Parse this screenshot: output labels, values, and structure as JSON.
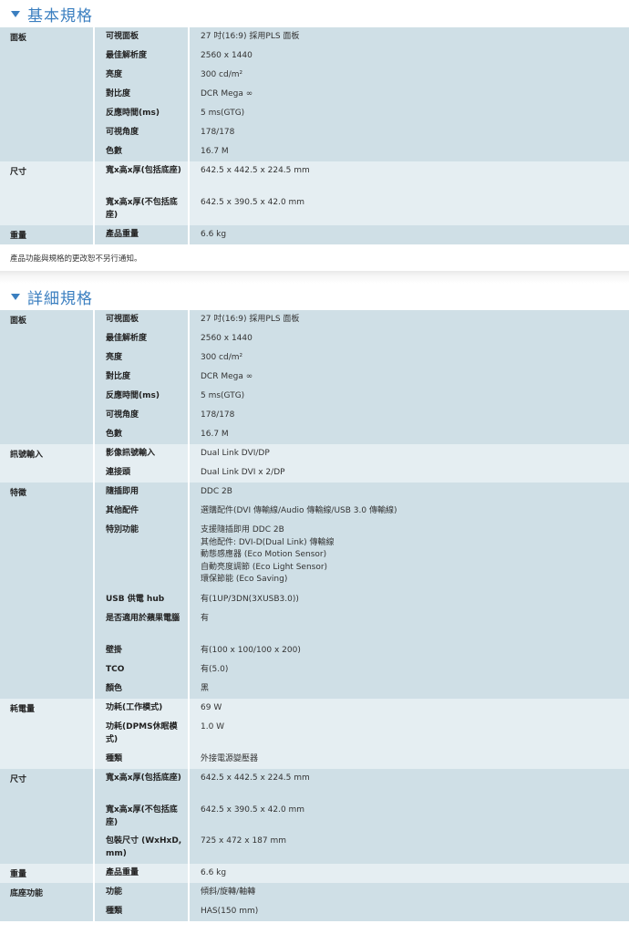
{
  "basic": {
    "title": "基本規格",
    "groups": [
      {
        "label": "面板",
        "rows": [
          {
            "name": "可視面板",
            "value": "27 吋(16:9) 採用PLS 面板"
          },
          {
            "name": "最佳解析度",
            "value": "2560 x 1440"
          },
          {
            "name": "亮度",
            "value": "300 cd/m²"
          },
          {
            "name": "對比度",
            "value": "DCR Mega ∞"
          },
          {
            "name": "反應時間(ms)",
            "value": "5 ms(GTG)"
          },
          {
            "name": "可視角度",
            "value": "178/178"
          },
          {
            "name": "色數",
            "value": "16.7 M"
          }
        ]
      },
      {
        "label": "尺寸",
        "rows": [
          {
            "name": "寬x高x厚(包括底座)",
            "value": "642.5 x 442.5 x 224.5 mm"
          },
          {
            "name": "寬x高x厚(不包括底座)",
            "value": "642.5 x 390.5 x 42.0 mm"
          }
        ]
      },
      {
        "label": "重量",
        "rows": [
          {
            "name": "產品重量",
            "value": "6.6 kg"
          }
        ]
      }
    ],
    "note": "產品功能與規格的更改恕不另行通知。"
  },
  "detail": {
    "title": "詳細規格",
    "groups": [
      {
        "label": "面板",
        "rows": [
          {
            "name": "可視面板",
            "value": "27 吋(16:9) 採用PLS 面板"
          },
          {
            "name": "最佳解析度",
            "value": "2560 x 1440"
          },
          {
            "name": "亮度",
            "value": "300 cd/m²"
          },
          {
            "name": "對比度",
            "value": "DCR Mega ∞"
          },
          {
            "name": "反應時間(ms)",
            "value": "5 ms(GTG)"
          },
          {
            "name": "可視角度",
            "value": "178/178"
          },
          {
            "name": "色數",
            "value": "16.7 M"
          }
        ]
      },
      {
        "label": "訊號輸入",
        "rows": [
          {
            "name": "影像訊號輸入",
            "value": "Dual Link DVI/DP"
          },
          {
            "name": "連接頭",
            "value": "Dual Link DVI x 2/DP"
          }
        ]
      },
      {
        "label": "特徵",
        "rows": [
          {
            "name": "隨插即用",
            "value": "DDC 2B"
          },
          {
            "name": "其他配件",
            "value": "選購配件(DVI 傳輸線/Audio 傳輸線/USB 3.0 傳輸線)"
          },
          {
            "name": "特別功能",
            "value": "支援隨插即用 DDC 2B\n其他配件: DVI-D(Dual Link) 傳輸線\n動態感應器 (Eco Motion Sensor)\n自動亮度調節 (Eco Light Sensor)\n環保節能 (Eco Saving)"
          },
          {
            "name": "USB 供電 hub",
            "value": "有(1UP/3DN(3XUSB3.0))"
          },
          {
            "name": "是否適用於蘋果電腦",
            "value": "有"
          },
          {
            "name": "壁掛",
            "value": "有(100 x 100/100 x 200)"
          },
          {
            "name": "TCO",
            "value": "有(5.0)"
          },
          {
            "name": "顏色",
            "value": "黑"
          }
        ]
      },
      {
        "label": "耗電量",
        "rows": [
          {
            "name": "功耗(工作模式)",
            "value": "69 W"
          },
          {
            "name": "功耗(DPMS休眠模式)",
            "value": "1.0 W"
          },
          {
            "name": "種類",
            "value": "外接電源變壓器"
          }
        ]
      },
      {
        "label": "尺寸",
        "rows": [
          {
            "name": "寬x高x厚(包括底座)",
            "value": "642.5 x 442.5 x 224.5 mm"
          },
          {
            "name": "寬x高x厚(不包括底座)",
            "value": "642.5 x 390.5 x 42.0 mm"
          },
          {
            "name": "包裝尺寸 (WxHxD, mm)",
            "value": "725 x 472 x 187 mm"
          }
        ]
      },
      {
        "label": "重量",
        "rows": [
          {
            "name": "產品重量",
            "value": "6.6 kg"
          }
        ]
      },
      {
        "label": "底座功能",
        "rows": [
          {
            "name": "功能",
            "value": "傾斜/旋轉/軸轉"
          },
          {
            "name": "種類",
            "value": "HAS(150 mm)"
          }
        ]
      }
    ]
  }
}
